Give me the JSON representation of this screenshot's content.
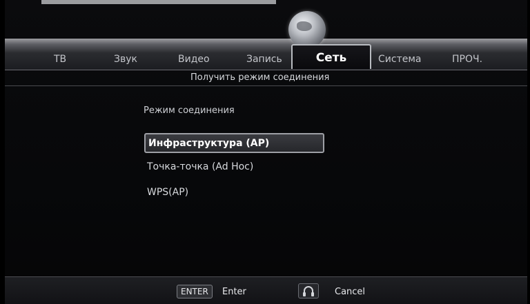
{
  "menu": {
    "tabs": [
      {
        "label": "ТВ"
      },
      {
        "label": "Звук"
      },
      {
        "label": "Видео"
      },
      {
        "label": "Запись"
      },
      {
        "label": "Сеть",
        "active": true
      },
      {
        "label": "Система"
      },
      {
        "label": "ПРОЧ."
      }
    ]
  },
  "page": {
    "subtitle": "Получить режим соединения",
    "section_label": "Режим соединения",
    "options": [
      {
        "label": "Инфраструктура (AP)",
        "selected": true
      },
      {
        "label": "Точка-точка (Ad Hoc)"
      },
      {
        "label": "WPS(AP)"
      }
    ]
  },
  "footer": {
    "enter_key": "ENTER",
    "enter_label": "Enter",
    "cancel_icon": "headset-icon",
    "cancel_label": "Cancel"
  },
  "colors": {
    "background": "#000000",
    "menu_band": "#5d5e63",
    "selected_border": "#9ea0a6",
    "text": "#d8dade"
  }
}
